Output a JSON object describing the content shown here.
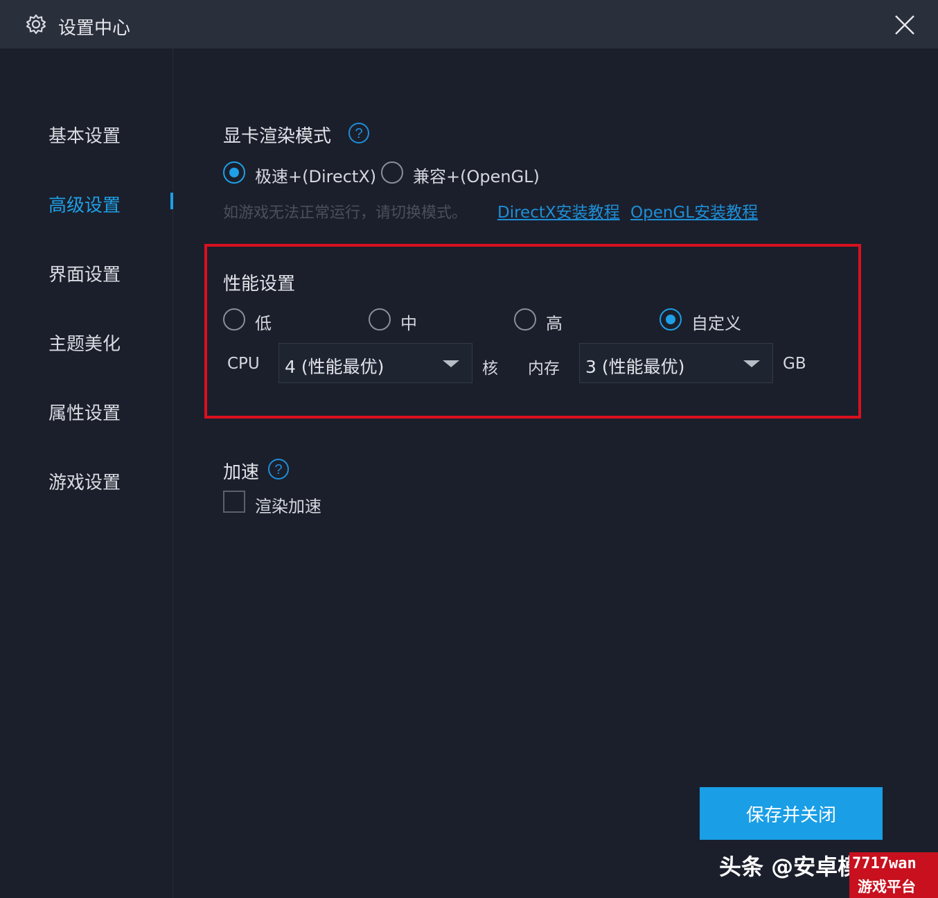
{
  "window": {
    "title": "设置中心",
    "title_icon": "gear-icon",
    "close_icon": "close-icon"
  },
  "sidebar": {
    "items": [
      {
        "label": "基本设置",
        "active": false
      },
      {
        "label": "高级设置",
        "active": true
      },
      {
        "label": "界面设置",
        "active": false
      },
      {
        "label": "主题美化",
        "active": false
      },
      {
        "label": "属性设置",
        "active": false
      },
      {
        "label": "游戏设置",
        "active": false
      }
    ]
  },
  "render_mode": {
    "title": "显卡渲染模式",
    "help_icon": "question-circle-icon",
    "options": [
      {
        "label": "极速+(DirectX)",
        "checked": true
      },
      {
        "label": "兼容+(OpenGL)",
        "checked": false
      }
    ],
    "hint": "如游戏无法正常运行，请切换模式。",
    "links": [
      "DirectX安装教程",
      "OpenGL安装教程"
    ]
  },
  "performance": {
    "title": "性能设置",
    "options": [
      {
        "label": "低",
        "checked": false
      },
      {
        "label": "中",
        "checked": false
      },
      {
        "label": "高",
        "checked": false
      },
      {
        "label": "自定义",
        "checked": true
      }
    ],
    "cpu_label": "CPU",
    "cpu_value": "4 (性能最优)",
    "cpu_unit": "核",
    "memory_label": "内存",
    "memory_value": "3 (性能最优)",
    "memory_unit": "GB"
  },
  "acceleration": {
    "title": "加速",
    "help_icon": "question-circle-icon",
    "checkbox_label": "渲染加速",
    "checked": false
  },
  "footer": {
    "save_label": "保存并关闭"
  },
  "overlay": {
    "watermark": "头条 @安卓模拟",
    "logo_top": "7717wan",
    "logo_bottom": "游戏平台"
  },
  "colors": {
    "accent": "#1e9fe6",
    "background": "#1b1f2b",
    "titlebar": "#2a2f3c",
    "highlight_box": "#d9101e"
  }
}
